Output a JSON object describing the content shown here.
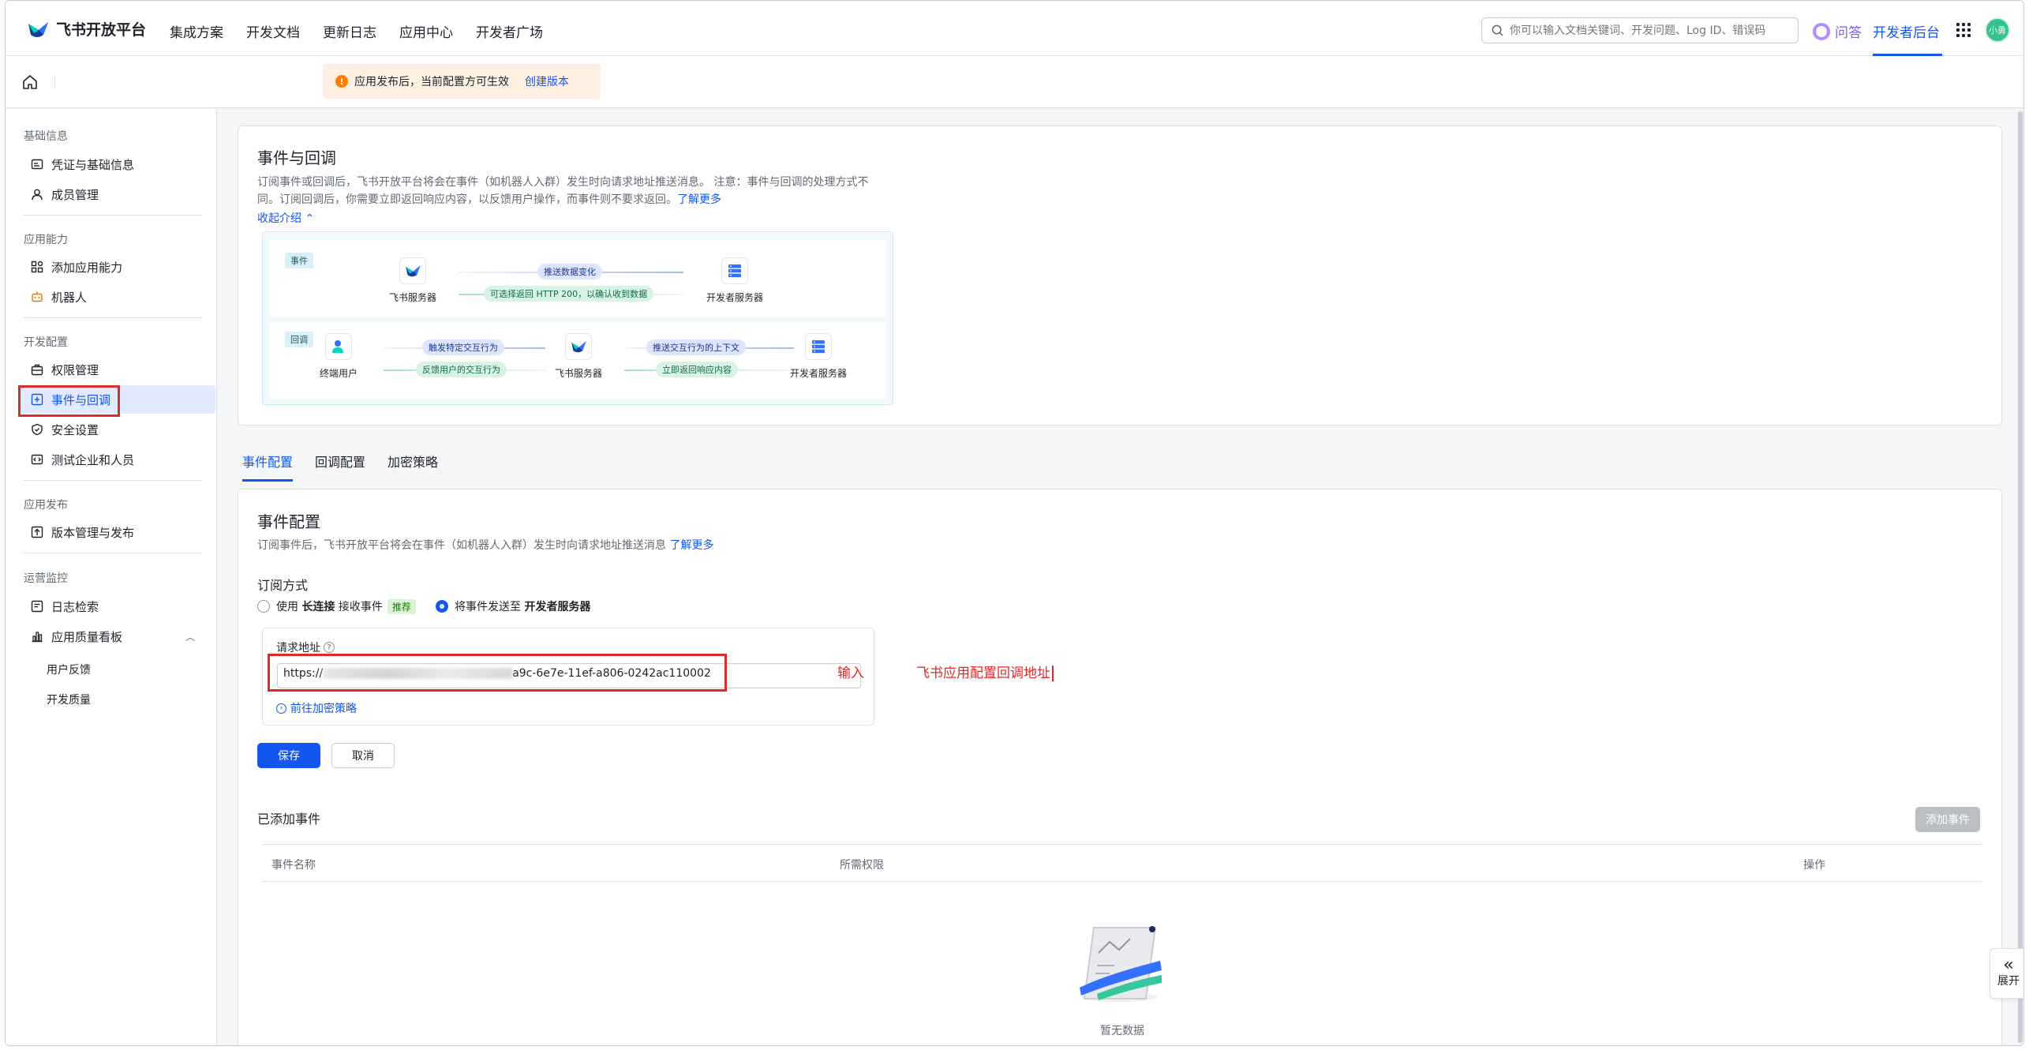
{
  "topnav": {
    "logo_text": "飞书开放平台",
    "items": [
      "集成方案",
      "开发文档",
      "更新日志",
      "应用中心",
      "开发者广场"
    ],
    "search_placeholder": "你可以输入文档关键词、开发问题、Log ID、错误码",
    "qa_label": "问答",
    "console_label": "开发者后台",
    "avatar_text": "小勇"
  },
  "notice": {
    "text": "应用发布后，当前配置方可生效",
    "link": "创建版本"
  },
  "sidebar": {
    "groups": [
      {
        "title": "基础信息",
        "items": [
          "凭证与基础信息",
          "成员管理"
        ]
      },
      {
        "title": "应用能力",
        "items": [
          "添加应用能力",
          "机器人"
        ]
      },
      {
        "title": "开发配置",
        "items": [
          "权限管理",
          "事件与回调",
          "安全设置",
          "测试企业和人员"
        ]
      },
      {
        "title": "应用发布",
        "items": [
          "版本管理与发布"
        ]
      },
      {
        "title": "运营监控",
        "items": [
          "日志检索",
          "应用质量看板"
        ],
        "subitems": [
          "用户反馈",
          "开发质量"
        ]
      }
    ]
  },
  "intro": {
    "title": "事件与回调",
    "desc_line1": "订阅事件或回调后，飞书开放平台将会在事件（如机器人入群）发生时向请求地址推送消息。 注意：事件与回调的处理方式不",
    "desc_line2": "同。订阅回调后，你需要立即返回响应内容，以反馈用户操作，而事件则不要求返回。",
    "learn_more": "了解更多",
    "collapse": "收起介绍",
    "event_tag": "事件",
    "callback_tag": "回调",
    "feishu_server": "飞书服务器",
    "dev_server": "开发者服务器",
    "end_user": "终端用户",
    "push_change": "推送数据变化",
    "optional_return": "可选择返回 HTTP 200，以确认收到数据",
    "trigger": "触发特定交互行为",
    "feedback": "反馈用户的交互行为",
    "push_context": "推送交互行为的上下文",
    "return_immediately": "立即返回响应内容"
  },
  "tabs": [
    "事件配置",
    "回调配置",
    "加密策略"
  ],
  "event_config": {
    "title": "事件配置",
    "desc": "订阅事件后，飞书开放平台将会在事件（如机器人入群）发生时向请求地址推送消息",
    "learn_more": "了解更多",
    "subscribe_label": "订阅方式",
    "option1_pre": "使用",
    "option1_bold": "长连接",
    "option1_post": "接收事件",
    "option1_badge": "推荐",
    "option2_pre": "将事件发送至",
    "option2_bold": "开发者服务器",
    "request_url_label": "请求地址",
    "url_prefix": "https://",
    "url_suffix": "a9c-6e7e-11ef-a806-0242ac110002",
    "encrypt_link": "前往加密策略",
    "save": "保存",
    "cancel": "取消"
  },
  "events_table": {
    "title": "已添加事件",
    "add_button": "添加事件",
    "columns": [
      "事件名称",
      "所需权限",
      "操作"
    ],
    "empty": "暂无数据"
  },
  "annotations": {
    "input": "输入",
    "note": "飞书应用配置回调地址"
  },
  "expand_label": "展开",
  "colors": {
    "accent": "#1456f0",
    "annotation_red": "#e0292b",
    "notice_orange": "#ff7d00"
  }
}
